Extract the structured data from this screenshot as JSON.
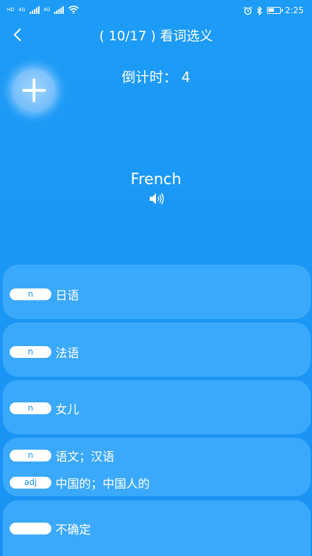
{
  "status_bar": {
    "left_label_1": "HD",
    "network_1": "4G",
    "network_2": "4G",
    "time": "2:25"
  },
  "header": {
    "title": "( 10/17 ) 看词选义",
    "countdown": "倒计时：  4"
  },
  "word": {
    "text": "French"
  },
  "options": [
    {
      "rows": [
        {
          "pos": "n",
          "meaning": "日语"
        }
      ]
    },
    {
      "rows": [
        {
          "pos": "n",
          "meaning": "法语"
        }
      ]
    },
    {
      "rows": [
        {
          "pos": "n",
          "meaning": "女儿"
        }
      ]
    },
    {
      "rows": [
        {
          "pos": "n",
          "meaning": "语文；汉语"
        },
        {
          "pos": "adj",
          "meaning": "中国的；中国人的"
        }
      ]
    },
    {
      "rows": [
        {
          "pos": "",
          "meaning": "不确定"
        }
      ]
    }
  ],
  "colors": {
    "background": "#1d9cf7",
    "option_card": "#3ba9fb",
    "pill_text": "#1a8ef0"
  }
}
